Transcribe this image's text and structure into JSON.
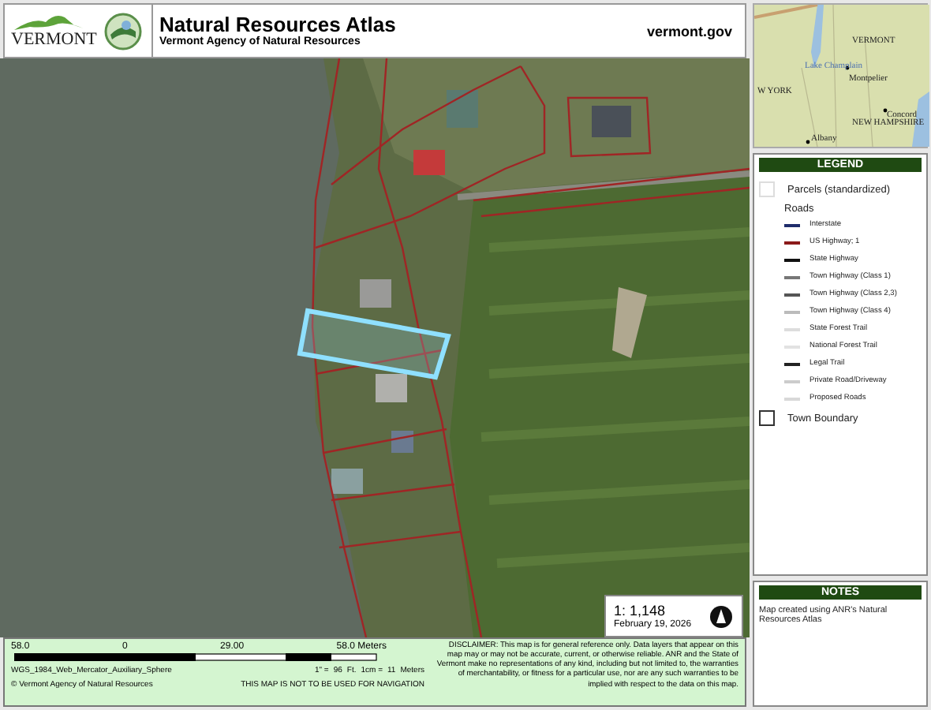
{
  "header": {
    "logo_text": "VERMONT",
    "title": "Natural Resources Atlas",
    "subtitle": "Vermont Agency of Natural Resources",
    "site": "vermont.gov"
  },
  "locator_map": {
    "labels": [
      "VERMONT",
      "Lake Champlain",
      "Montpelier",
      "W YORK",
      "Concord",
      "NEW HAMPSHIRE",
      "Albany"
    ]
  },
  "map": {
    "scale": "1: 1,148",
    "date": "February 19, 2026"
  },
  "legend": {
    "title": "LEGEND",
    "items": [
      {
        "kind": "box",
        "label": "Parcels (standardized)",
        "color": "#dddddd"
      },
      {
        "kind": "heading",
        "label": "Roads"
      },
      {
        "kind": "line",
        "label": "Interstate",
        "color": "#1f2d6b"
      },
      {
        "kind": "line",
        "label": "US Highway; 1",
        "color": "#8b1a1a"
      },
      {
        "kind": "line",
        "label": "State Highway",
        "color": "#111111"
      },
      {
        "kind": "line",
        "label": "Town Highway (Class 1)",
        "color": "#777777"
      },
      {
        "kind": "line",
        "label": "Town Highway (Class 2,3)",
        "color": "#555555"
      },
      {
        "kind": "line",
        "label": "Town Highway (Class 4)",
        "color": "#bbbbbb"
      },
      {
        "kind": "line",
        "label": "State Forest Trail",
        "color": "#dddddd"
      },
      {
        "kind": "line",
        "label": "National Forest Trail",
        "color": "#e2e2e2"
      },
      {
        "kind": "line",
        "label": "Legal Trail",
        "color": "#222222"
      },
      {
        "kind": "line",
        "label": "Private Road/Driveway",
        "color": "#cccccc"
      },
      {
        "kind": "line",
        "label": "Proposed Roads",
        "color": "#d8d8d8"
      },
      {
        "kind": "box",
        "label": "Town Boundary",
        "color": "#333333"
      }
    ]
  },
  "notes": {
    "title": "NOTES",
    "text": "Map created using ANR's Natural Resources Atlas"
  },
  "footer": {
    "scale_labels": [
      "58.0",
      "0",
      "29.00",
      "58.0 Meters"
    ],
    "projection": "WGS_1984_Web_Mercator_Auxiliary_Sphere",
    "conversion": [
      "1\" =",
      "96",
      "Ft.",
      "1cm =",
      "11",
      "Meters"
    ],
    "copyright": "© Vermont Agency of Natural Resources",
    "warning": "THIS MAP IS NOT TO BE USED FOR NAVIGATION",
    "disclaimer": "DISCLAIMER: This map is for general reference only. Data layers that appear on this map may or may not be accurate, current, or otherwise reliable. ANR and the State of Vermont make no representations of any kind, including but not limited to, the warranties of merchantability, or fitness for a particular use, nor are any such warranties to be implied with respect to the data on this map."
  }
}
